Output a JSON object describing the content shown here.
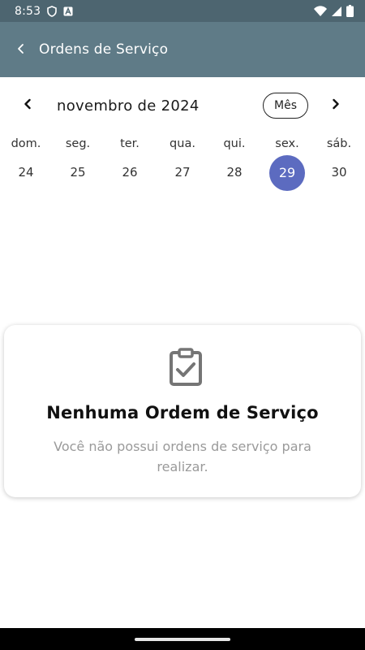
{
  "status_bar": {
    "time": "8:53",
    "icons": [
      "shield-icon",
      "font-a-icon",
      "wifi-icon",
      "signal-icon",
      "battery-icon"
    ]
  },
  "app_bar": {
    "title": "Ordens de Serviço",
    "back_icon": "chevron-left-icon"
  },
  "calendar": {
    "month_label": "novembro de 2024",
    "format_button": "Mês",
    "weekdays": [
      "dom.",
      "seg.",
      "ter.",
      "qua.",
      "qui.",
      "sex.",
      "sáb."
    ],
    "days": [
      "24",
      "25",
      "26",
      "27",
      "28",
      "29",
      "30"
    ],
    "selected_day": "29",
    "accent_color": "#5c6bc0"
  },
  "empty_state": {
    "icon": "clipboard-check-icon",
    "title": "Nenhuma Ordem de Serviço",
    "message": "Você não possui ordens de serviço para realizar."
  },
  "colors": {
    "status_bar": "#4d6570",
    "app_bar": "#5f7b87",
    "selected_day": "#5c6bc0"
  }
}
